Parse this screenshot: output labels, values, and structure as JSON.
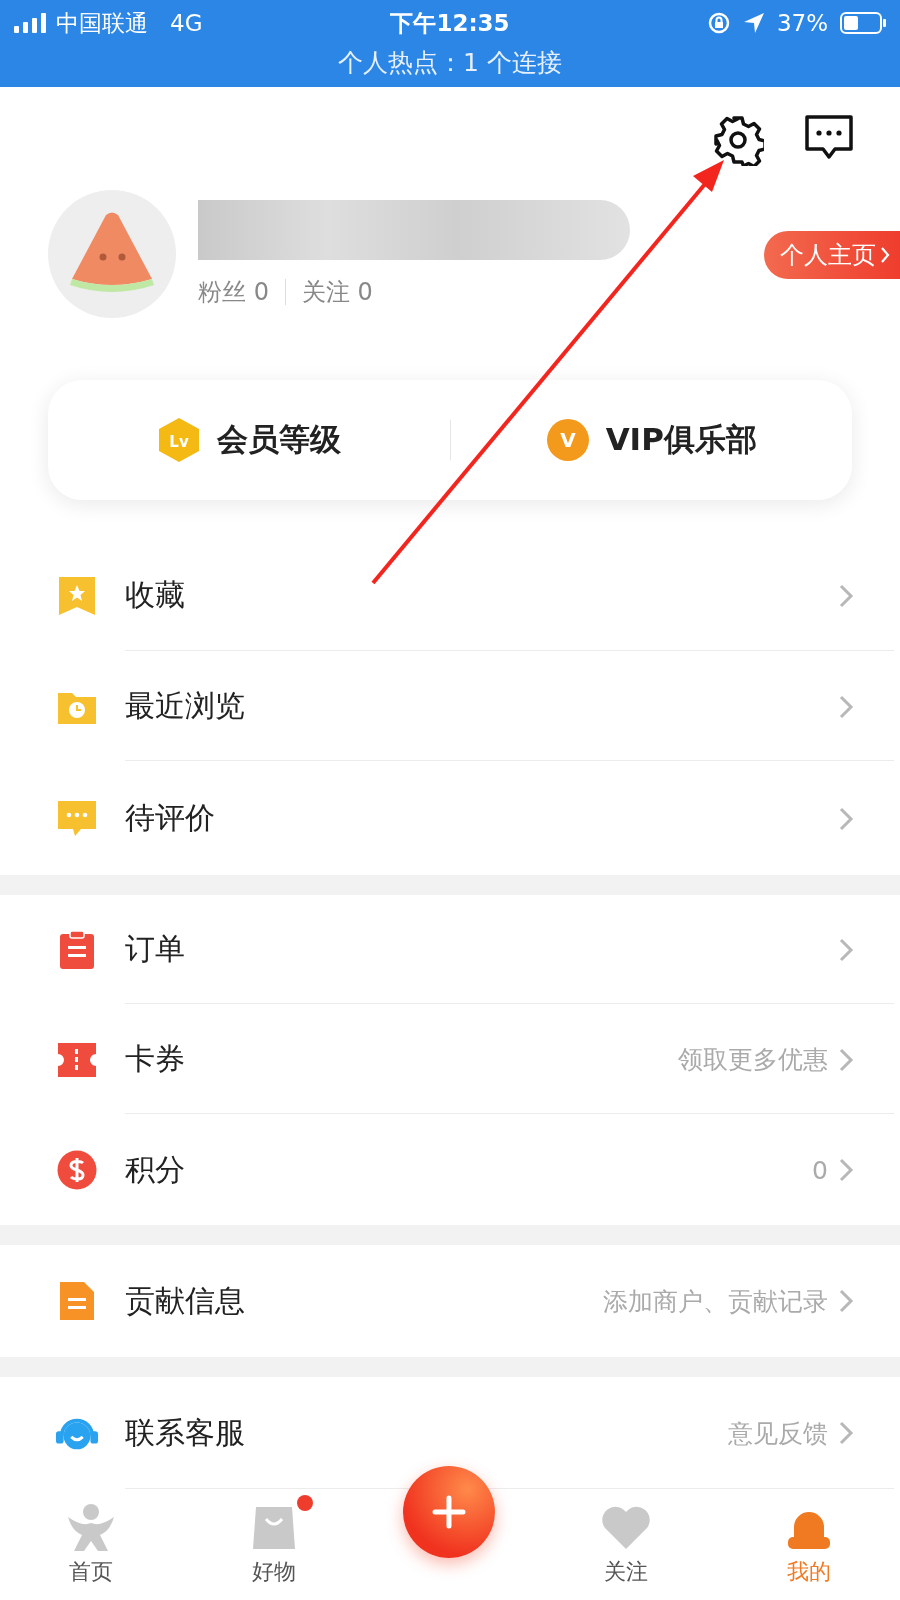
{
  "status_bar": {
    "carrier": "中国联通",
    "network": "4G",
    "time": "下午12:35",
    "battery": "37%",
    "hotspot": "个人热点：1 个连接"
  },
  "profile": {
    "stats": [
      "粉丝 0",
      "关注 0"
    ],
    "homepage_link": "个人主页"
  },
  "membership": [
    {
      "badge": "Lv",
      "label": "会员等级"
    },
    {
      "badge": "V",
      "label": "VIP俱乐部"
    }
  ],
  "menu_groups": [
    [
      {
        "label": "收藏"
      },
      {
        "label": "最近浏览"
      },
      {
        "label": "待评价"
      }
    ],
    [
      {
        "label": "订单"
      },
      {
        "label": "卡券",
        "hint": "领取更多优惠"
      },
      {
        "label": "积分",
        "hint": "0"
      }
    ],
    [
      {
        "label": "贡献信息",
        "hint": "添加商户、贡献记录"
      }
    ],
    [
      {
        "label": "联系客服",
        "hint": "意见反馈"
      }
    ]
  ],
  "tab_bar": [
    {
      "label": "首页",
      "selected": false,
      "badge": false
    },
    {
      "label": "好物",
      "selected": false,
      "badge": true
    },
    {
      "label": "关注",
      "selected": false,
      "badge": false
    },
    {
      "label": "我的",
      "selected": true,
      "badge": false
    }
  ]
}
